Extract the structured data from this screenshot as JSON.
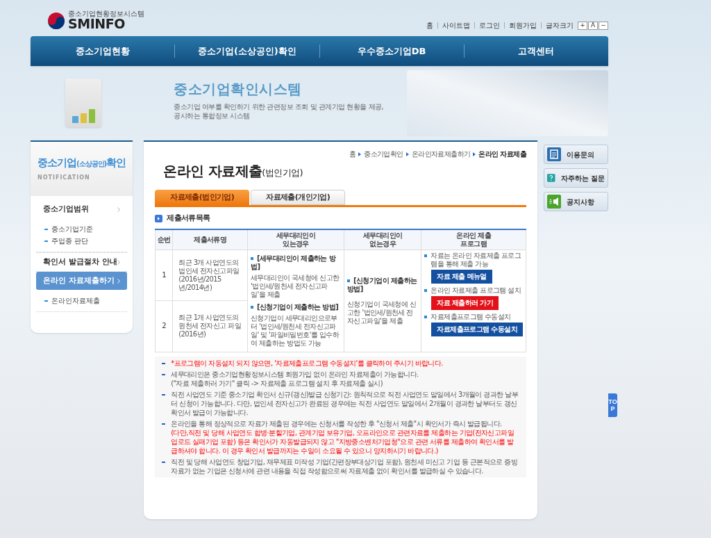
{
  "header": {
    "logo_caption": "중소기업현황정보시스템",
    "logo_text": "SMINFO",
    "util_links": [
      "홈",
      "사이트맵",
      "로그인",
      "회원가입"
    ],
    "font_size_label": "글자크기",
    "font_buttons": [
      "+",
      "A",
      "−"
    ]
  },
  "nav": [
    "중소기업현황",
    "중소기업(소상공인)확인",
    "우수중소기업DB",
    "고객센터"
  ],
  "banner": {
    "title": "중소기업확인시스템",
    "description": "중소기업 여부를 확인하기 위한 관련정보 조회 및 관계기업 현황을 제공,\n공시하는 통합정보 시스템"
  },
  "sidebar": {
    "title_main": "중소기업",
    "title_small": "(소상공인)",
    "title_end": "확인",
    "subtitle": "NOTIFICATION",
    "items": [
      {
        "label": "중소기업범위",
        "selected": false,
        "children": [
          {
            "label": "중소기업기준"
          },
          {
            "label": "주업종 판단"
          }
        ]
      },
      {
        "label": "확인서 발급절차 안내",
        "selected": false
      },
      {
        "label": "온라인 자료제출하기",
        "selected": true,
        "children": [
          {
            "label": "온라인자료제출"
          }
        ]
      }
    ]
  },
  "breadcrumb": [
    "홈",
    "중소기업확인",
    "온라인자료제출하기",
    "온라인 자료제출"
  ],
  "page_title": {
    "main": "온라인 자료제출",
    "sub": "(법인기업)"
  },
  "tabs": [
    {
      "label": "자료제출(법인기업)",
      "selected": true
    },
    {
      "label": "자료제출(개인기업)",
      "selected": false
    }
  ],
  "section_title": "제출서류목록",
  "table": {
    "columns": [
      "순번",
      "제출서류명",
      "세무대리인이\n있는경우",
      "세무대리인이\n없는경우",
      "온라인 제출\n프로그램"
    ],
    "rows": [
      {
        "no": "1",
        "document": "최근 3개 사업연도의 법인세 전자신고파일 (2016년/2015년/2014년)"
      },
      {
        "no": "2",
        "document": "최근 1개 사업연도의 원천세 전자신고 파일 (2016년)"
      }
    ],
    "with_agent": [
      {
        "heading": "[세무대리인이 제출하는 방법]",
        "text": "세무대리인이 국세청에 신고한 '법인세/원천세 전자신고파일'을 제출"
      },
      {
        "heading": "[신청기업이 제출하는 방법]",
        "text": "신청기업이 세무대리인으로부터 '법인세/원천세 전자신고파일' 및 '파일비밀번호'를 입수하여 제출하는 방법도 가능"
      }
    ],
    "without_agent": [
      {
        "heading": "[신청기업이 제출하는 방법]",
        "text": "신청기업이 국세청에 신고한 '법인세/원천세 전자신고파일'을 제출"
      }
    ],
    "program": [
      {
        "text": "자료는 온라인 자료제출 프로그램을 통해 제출 가능",
        "button": "자료 제출 메뉴얼",
        "kind": "primary"
      },
      {
        "text": "온라인 자료제출 프로그램 설치",
        "button": "자료 제출하러 가기",
        "kind": "danger"
      },
      {
        "text": "자료제출프로그램 수동설치",
        "button": "자료제출프로그램 수동설치",
        "kind": "primary"
      }
    ]
  },
  "notes": [
    {
      "paragraphs": [
        {
          "kind": "alert",
          "text": "*프로그램이 자동설치 되지 않으면, '자료제출프로그램 수동설치'를 클릭하여 주시기 바랍니다."
        }
      ]
    },
    {
      "paragraphs": [
        {
          "kind": "normal",
          "text": "세무대리인은 중소기업현황정보시스템 회원가입 없이 온라인 자료제출이 가능합니다."
        },
        {
          "kind": "normal",
          "text": "(\"자료 제출하러 가기\" 클릭 -> 자료제출 프로그램 설치 후 자료제출 실시)"
        }
      ]
    },
    {
      "paragraphs": [
        {
          "kind": "normal",
          "text": "직전 사업연도 기준 중소기업 확인서 신규(갱신)발급 신청기간: 원칙적으로 직전 사업연도 말일에서 3개월이 경과한 날부터 신청이 가능합니다. 다만, 법인세 전자신고가 완료된 경우에는 직전 사업연도 말일에서 2개월이 경과한 날부터도 갱신 확인서 발급이 가능합니다."
        }
      ]
    },
    {
      "paragraphs": [
        {
          "kind": "normal",
          "text": "온라인을 통해 정상적으로 자료가 제출된 경우에는 신청서를 작성한 후 \"신청서 제출\"시 확인서가 즉시 발급됩니다."
        },
        {
          "kind": "alert",
          "text": "(다만,직전 및 당해 사업연도 합병·분할기업, 관계기업 보유기업, 오프라인으로 관련자료를 제출하는 기업(전자신고파일 업로드 실패기업 포함) 등은 확인서가 자동발급되지 않고 \"지방중소벤처기업청\"으로 관련 서류를 제출하여 확인서를 발급하셔야 합니다. 이 경우 확인서 발급까지는 수일이 소요될 수 있으니 양지하시기 바랍니다.)"
        }
      ]
    },
    {
      "paragraphs": [
        {
          "kind": "normal",
          "text": "직전 및 당해 사업연도 창업기업, 재무제표 미작성 기업(간편장부대상기업 포함), 원천세 미신고 기업 등 근본적으로 증빙자료가 없는 기업은 신청서에 관련 내용을 직접 작성함으로써 자료제출 없이 확인서를 발급하실 수 있습니다."
        }
      ]
    }
  ],
  "quick_links": [
    {
      "label": "이용문의",
      "kind": "document"
    },
    {
      "label": "자주하는 질문",
      "kind": "question"
    },
    {
      "label": "공지사항",
      "kind": "notice"
    }
  ],
  "top_button": "TOP"
}
